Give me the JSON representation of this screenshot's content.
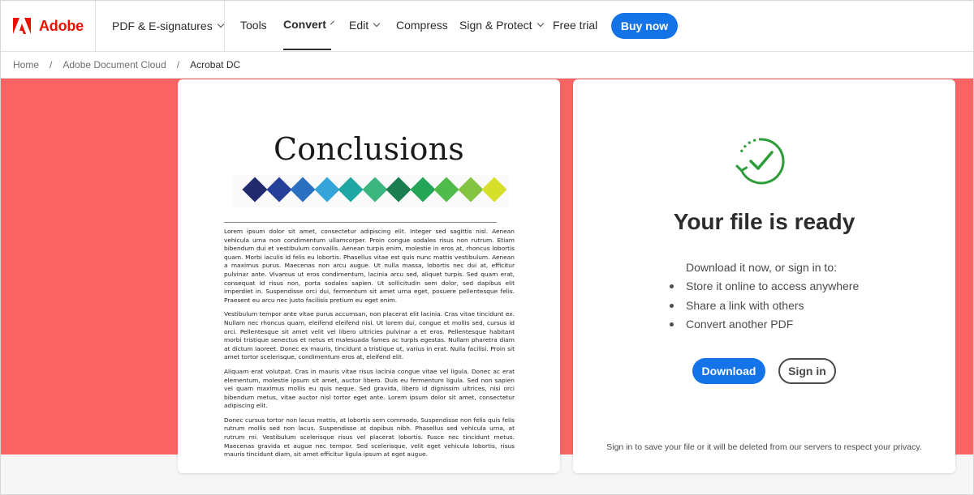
{
  "brand": {
    "name": "Adobe",
    "color": "#eb1000"
  },
  "nav": {
    "product_label": "PDF & E-signatures",
    "items": [
      {
        "label": "Tools",
        "has_menu": false,
        "active": false
      },
      {
        "label": "Convert",
        "has_menu": true,
        "active": true
      },
      {
        "label": "Edit",
        "has_menu": true,
        "active": false
      },
      {
        "label": "Compress",
        "has_menu": false,
        "active": false
      },
      {
        "label": "Sign & Protect",
        "has_menu": true,
        "active": false
      },
      {
        "label": "Free trial",
        "has_menu": false,
        "active": false
      }
    ],
    "buy_label": "Buy now"
  },
  "breadcrumb": {
    "items": [
      "Home",
      "Adobe Document Cloud",
      "Acrobat DC"
    ],
    "separator": "/"
  },
  "colors": {
    "accent": "#1473e6",
    "band": "#fa6464",
    "success": "#2d9d3a"
  },
  "preview": {
    "title": "Conclusions",
    "swatches": [
      "#222a6e",
      "#26409a",
      "#2a6fc0",
      "#35a4d8",
      "#21a7a3",
      "#3ab67e",
      "#1c7d51",
      "#24a456",
      "#4ebb4a",
      "#84c442",
      "#d6df2a"
    ],
    "paragraphs": [
      "Lorem ipsum dolor sit amet, consectetur adipiscing elit. Integer sed sagittis nisl. Aenean vehicula urna non condimentum ullamcorper. Proin congue sodales risus non rutrum. Etiam bibendum dui et vestibulum convallis. Aenean turpis enim, molestie in eros at, rhoncus lobortis quam. Morbi iaculis id felis eu lobortis. Phasellus vitae est quis nunc mattis vestibulum. Aenean a maximus purus. Maecenas non arcu augue. Ut nulla massa, lobortis nec dui at, efficitur pulvinar ante. Vivamus ut eros condimentum, lacinia arcu sed, aliquet turpis. Sed quam erat, consequat id risus non, porta sodales sapien. Ut sollicitudin sem dolor, sed dapibus elit imperdiet in. Suspendisse orci dui, fermentum sit amet urna eget, posuere pellentesque felis. Praesent eu arcu nec justo facilisis pretium eu eget enim.",
      "Vestibulum tempor ante vitae purus accumsan, non placerat elit lacinia. Cras vitae tincidunt ex. Nullam nec rhoncus quam, eleifend eleifend nisl. Ut lorem dui, congue et mollis sed, cursus id orci. Pellentesque sit amet velit vel libero ultricies pulvinar a et eros. Pellentesque habitant morbi tristique senectus et netus et malesuada fames ac turpis egestas. Nullam pharetra diam at dictum laoreet. Donec ex mauris, tincidunt a tristique ut, varius in erat. Nulla facilisi. Proin sit amet tortor scelerisque, condimentum eros at, eleifend elit.",
      "Aliquam erat volutpat. Cras in mauris vitae risus lacinia congue vitae vel ligula. Donec ac erat elementum, molestie ipsum sit amet, auctor libero. Duis eu fermentum ligula. Sed non sapien vel quam maximus mollis eu quis neque. Sed gravida, libero id dignissim ultrices, nisi orci bibendum metus, vitae auctor nisl tortor eget ante. Lorem ipsum dolor sit amet, consectetur adipiscing elit.",
      "Donec cursus tortor non lacus mattis, at lobortis sem commodo. Suspendisse non felis quis felis rutrum mollis sed non lacus. Suspendisse at dapibus nibh. Phasellus sed vehicula urna, at rutrum mi. Vestibulum scelerisque risus vel placerat lobortis. Fusce nec tincidunt metus. Maecenas gravida et augue nec tempor. Sed scelerisque, velit eget vehicula lobortis, risus mauris tincidunt diam, sit amet efficitur ligula ipsum at eget augue."
    ]
  },
  "ready": {
    "icon": "checkmark-refresh-icon",
    "title": "Your file is ready",
    "lead": "Download it now, or sign in to:",
    "bullets": [
      "Store it online to access anywhere",
      "Share a link with others",
      "Convert another PDF"
    ],
    "download_label": "Download",
    "signin_label": "Sign in",
    "privacy_note": "Sign in to save your file or it will be deleted from our servers to respect your privacy."
  }
}
